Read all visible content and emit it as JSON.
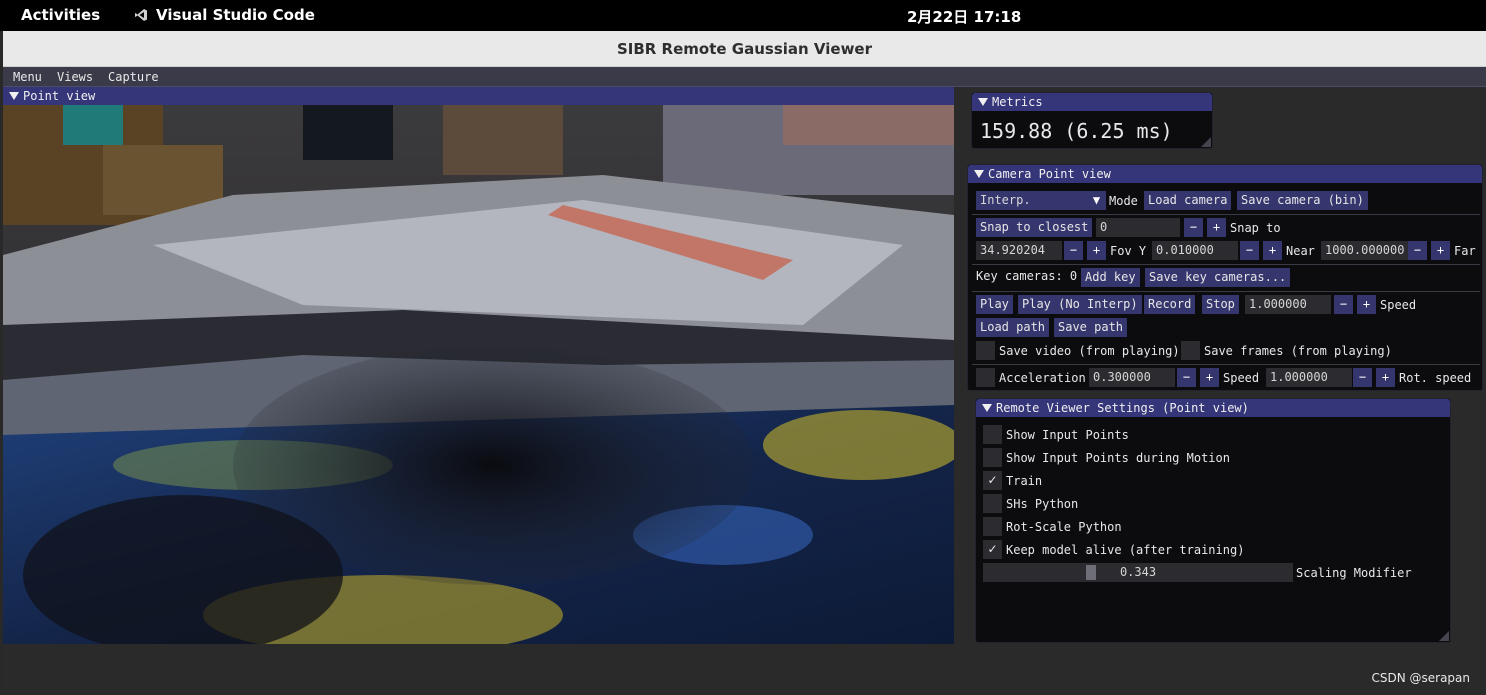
{
  "topbar": {
    "activities": "Activities",
    "app_name": "Visual Studio Code",
    "clock": "2月22日  17:18"
  },
  "window": {
    "title": "SIBR Remote Gaussian Viewer"
  },
  "menubar": {
    "items": [
      "Menu",
      "Views",
      "Capture"
    ]
  },
  "point_view": {
    "title": "Point view"
  },
  "metrics": {
    "title": "Metrics",
    "fps_text": "159.88 (6.25 ms)"
  },
  "camera": {
    "title": "Camera Point view",
    "mode_value": "Interp.",
    "mode_label": "Mode",
    "load_camera": "Load camera",
    "save_camera": "Save camera (bin)",
    "snap_to_closest": "Snap to closest",
    "snap_value": "0",
    "snap_to_label": "Snap to",
    "fovy_value": "34.920204",
    "fovy_label": "Fov Y",
    "near_value": "0.010000",
    "near_label": "Near",
    "far_value": "1000.000000",
    "far_label": "Far",
    "key_cameras_label": "Key cameras: 0",
    "add_key": "Add key",
    "save_key_cameras": "Save key cameras...",
    "play": "Play",
    "play_no_interp": "Play (No Interp)",
    "record": "Record",
    "stop": "Stop",
    "speed_value": "1.000000",
    "speed_label": "Speed",
    "load_path": "Load path",
    "save_path": "Save path",
    "save_video_label": "Save video (from playing)",
    "save_frames_label": "Save frames (from playing)",
    "acceleration_label": "Acceleration",
    "acceleration_value": "0.300000",
    "speed2_label": "Speed",
    "speed2_value": "1.000000",
    "rot_speed_label": "Rot. speed",
    "minus": "−",
    "plus": "+"
  },
  "remote": {
    "title": "Remote Viewer Settings (Point view)",
    "options": [
      {
        "label": "Show Input Points",
        "checked": false
      },
      {
        "label": "Show Input Points during Motion",
        "checked": false
      },
      {
        "label": "Train",
        "checked": true
      },
      {
        "label": "SHs Python",
        "checked": false
      },
      {
        "label": "Rot-Scale Python",
        "checked": false
      },
      {
        "label": "Keep model alive (after training)",
        "checked": true
      }
    ],
    "scaling_value": "0.343",
    "scaling_fraction": 0.343,
    "scaling_label": "Scaling Modifier"
  },
  "watermark": "CSDN @serapan",
  "colors": {
    "title_active": "#35357a",
    "button": "#36366e",
    "panel_bg": "#0c0c0f"
  }
}
